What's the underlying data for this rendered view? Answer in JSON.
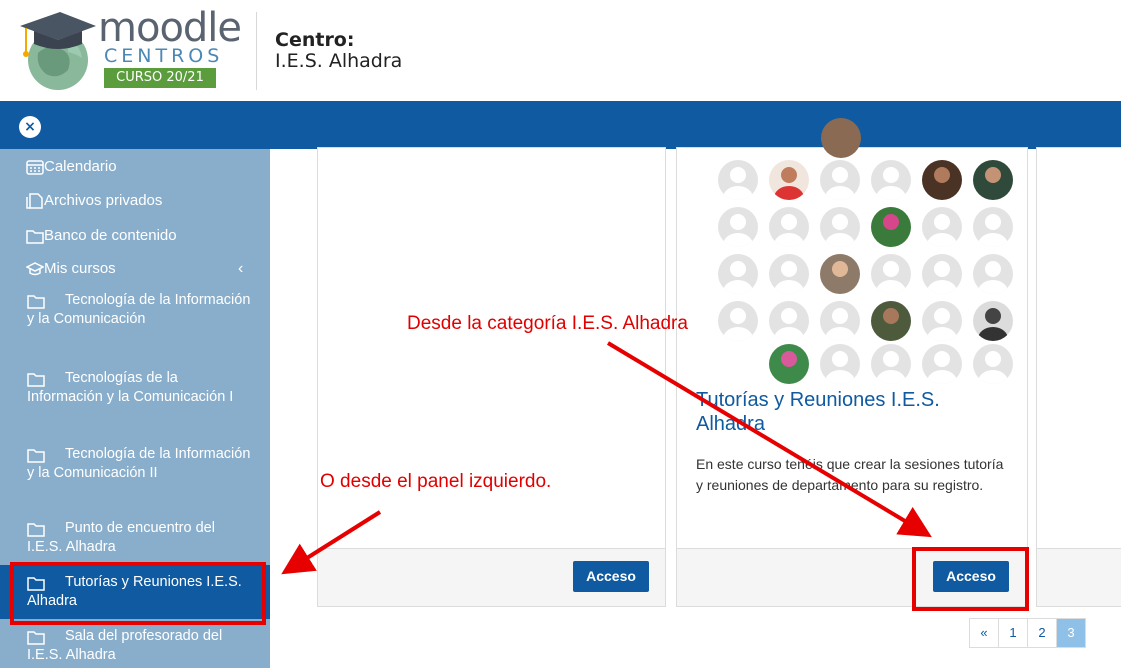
{
  "header": {
    "logo_word": "moodle",
    "logo_sub": "CENTROS",
    "logo_badge": "CURSO 20/21",
    "centro_label": "Centro:",
    "centro_name": "I.E.S. Alhadra"
  },
  "navbar": {
    "close_glyph": "×"
  },
  "sidebar": {
    "items": [
      {
        "label": "Calendario",
        "icon": "calendar-icon"
      },
      {
        "label": "Archivos privados",
        "icon": "file-icon"
      },
      {
        "label": "Banco de contenido",
        "icon": "folder-icon"
      },
      {
        "label": "Mis cursos",
        "icon": "graduation-cap-icon",
        "chevron": "‹"
      }
    ],
    "courses": [
      {
        "label": "Tecnología de la Información y la Comunicación"
      },
      {
        "label": "Tecnologías de la Información y la Comunicación I"
      },
      {
        "label": "Tecnología de la Información y la Comunicación II"
      },
      {
        "label": "Punto de encuentro del I.E.S. Alhadra"
      },
      {
        "label": "Tutorías y Reuniones I.E.S. Alhadra"
      },
      {
        "label": "Sala del profesorado del I.E.S. Alhadra"
      }
    ]
  },
  "main": {
    "cards": [
      {
        "button": "Acceso"
      },
      {
        "title": "Tutorías y Reuniones I.E.S. Alhadra",
        "description": "En este curso tenéis que crear la sesiones tutoría y reuniones de departamento para su registro.",
        "button": "Acceso"
      }
    ],
    "pagination": [
      "«",
      "1",
      "2",
      "3"
    ],
    "pagination_active": "3"
  },
  "annotations": {
    "category_note": "Desde la categoría I.E.S. Alhadra",
    "panel_note": "O desde el panel izquierdo."
  },
  "colors": {
    "primary": "#0f5aa0",
    "sidebar": "#89aecc",
    "annotation": "#e00000",
    "badge": "#5b9c3c"
  }
}
